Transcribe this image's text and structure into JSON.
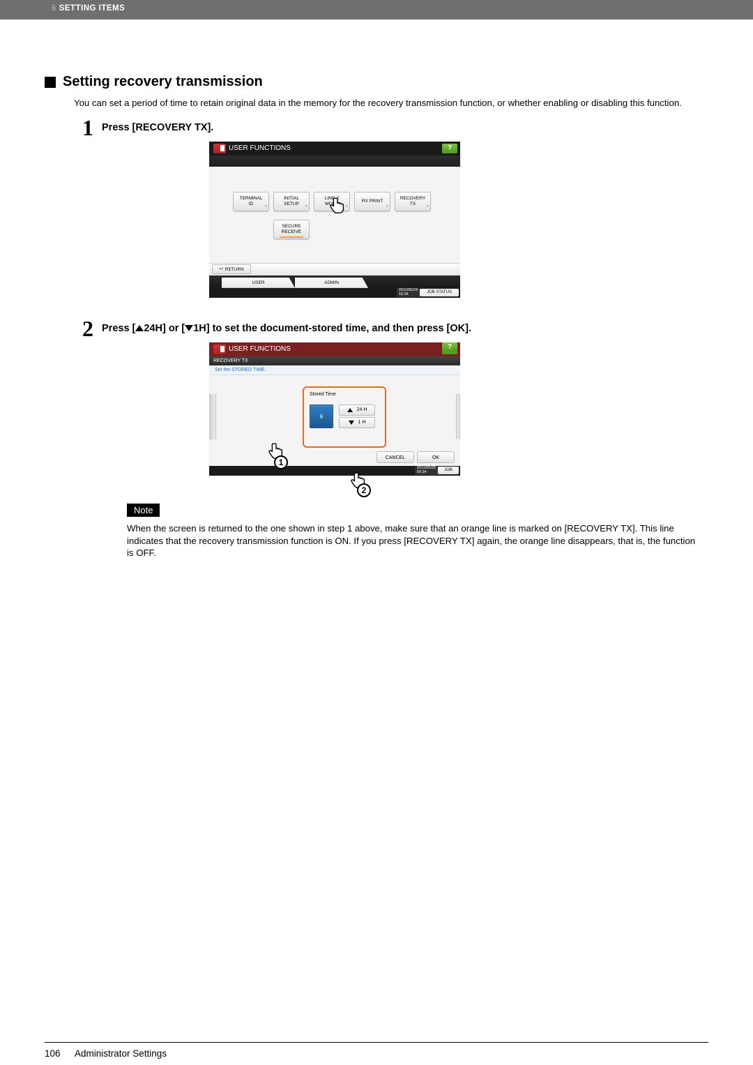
{
  "header": {
    "chapter_num": "6",
    "chapter_title": "SETTING ITEMS"
  },
  "section": {
    "title": "Setting recovery transmission",
    "intro": "You can set a period of time to retain original data in the memory for the recovery transmission function, or whether enabling or disabling this function."
  },
  "steps": {
    "s1": {
      "num": "1",
      "text": "Press [RECOVERY TX]."
    },
    "s2": {
      "num": "2",
      "prefix": "Press [",
      "mid1": "24H] or [",
      "mid2": "1H] to set the document-stored time, and then press [OK]."
    }
  },
  "shot1": {
    "title": "USER FUNCTIONS",
    "help": "?",
    "buttons": {
      "terminal": "TERMINAL\nID",
      "initial": "INITIAL\nSETUP",
      "line2": "LINE-2\nMODE",
      "rxprint": "RX PRINT",
      "recovery": "RECOVERY\nTX",
      "secure": "SECURE\nRECEIVE"
    },
    "return": "RETURN",
    "tabs": {
      "user": "USER",
      "admin": "ADMIN"
    },
    "date": "2011/05/24\n15:34",
    "job": "JOB STATUS"
  },
  "shot2": {
    "title": "USER FUNCTIONS",
    "crumb": "RECOVERY TX",
    "help": "?",
    "hint": "Set the STORED TIME.",
    "stored_label": "Stored Time",
    "value": "6",
    "up": "24 H",
    "down": "1 H",
    "cancel": "CANCEL",
    "ok": "OK",
    "date": "2011/05/25\n09:34",
    "job": "JOB"
  },
  "note": {
    "label": "Note",
    "text": "When the screen is returned to the one shown in step 1 above, make sure that an orange line is marked on [RECOVERY TX]. This line indicates that the recovery transmission function is ON. If you press [RECOVERY TX] again, the orange line disappears, that is, the function is OFF."
  },
  "footer": {
    "page": "106",
    "title": "Administrator Settings"
  }
}
